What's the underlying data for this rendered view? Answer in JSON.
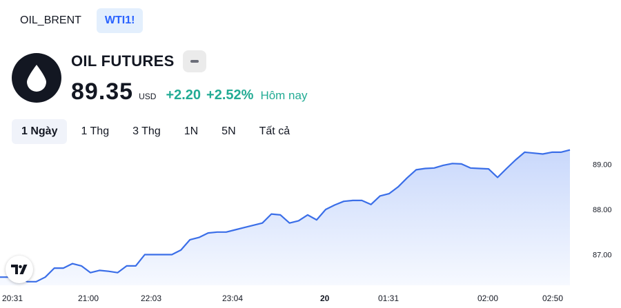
{
  "symbol_tabs": [
    {
      "label": "OIL_BRENT",
      "active": false
    },
    {
      "label": "WTI1!",
      "active": true
    }
  ],
  "header": {
    "title": "OIL FUTURES",
    "price": "89.35",
    "currency": "USD",
    "change_abs": "+2.20",
    "change_pct": "+2.52%",
    "period_label": "Hôm nay"
  },
  "ranges": [
    {
      "label": "1 Ngày",
      "active": true
    },
    {
      "label": "1 Thg",
      "active": false
    },
    {
      "label": "3 Thg",
      "active": false
    },
    {
      "label": "1N",
      "active": false
    },
    {
      "label": "5N",
      "active": false
    },
    {
      "label": "Tất cả",
      "active": false
    }
  ],
  "colors": {
    "line": "#3a6ee8",
    "area_top": "#c9d8fb",
    "area_bottom": "#f6f9ff",
    "positive": "#22ab94"
  },
  "icons": {
    "logo": "oil-drop-icon",
    "badge": "tradingview-logo-icon"
  },
  "chart_data": {
    "type": "area",
    "title": "",
    "xlabel": "",
    "ylabel": "",
    "ylim": [
      86.32,
      89.36
    ],
    "y_ticks": [
      "87.00",
      "88.00",
      "89.00"
    ],
    "x_tick_labels": [
      "20:31",
      "21:00",
      "22:03",
      "23:04",
      "20",
      "01:31",
      "02:00",
      "02:50"
    ],
    "grid": false,
    "series": [
      {
        "values": [
          86.5,
          86.5,
          86.5,
          86.4,
          86.4,
          86.5,
          86.7,
          86.7,
          86.8,
          86.75,
          86.6,
          86.65,
          86.63,
          86.6,
          86.75,
          86.75,
          87.0,
          87.0,
          87.0,
          87.0,
          87.1,
          87.33,
          87.38,
          87.48,
          87.5,
          87.5,
          87.55,
          87.6,
          87.65,
          87.7,
          87.9,
          87.88,
          87.7,
          87.75,
          87.88,
          87.77,
          88.0,
          88.1,
          88.18,
          88.2,
          88.2,
          88.11,
          88.3,
          88.35,
          88.5,
          88.7,
          88.88,
          88.91,
          88.92,
          88.98,
          89.02,
          89.01,
          88.92,
          88.91,
          88.9,
          88.71,
          88.91,
          89.1,
          89.27,
          89.25,
          89.23,
          89.27,
          89.27,
          89.32
        ]
      }
    ]
  }
}
